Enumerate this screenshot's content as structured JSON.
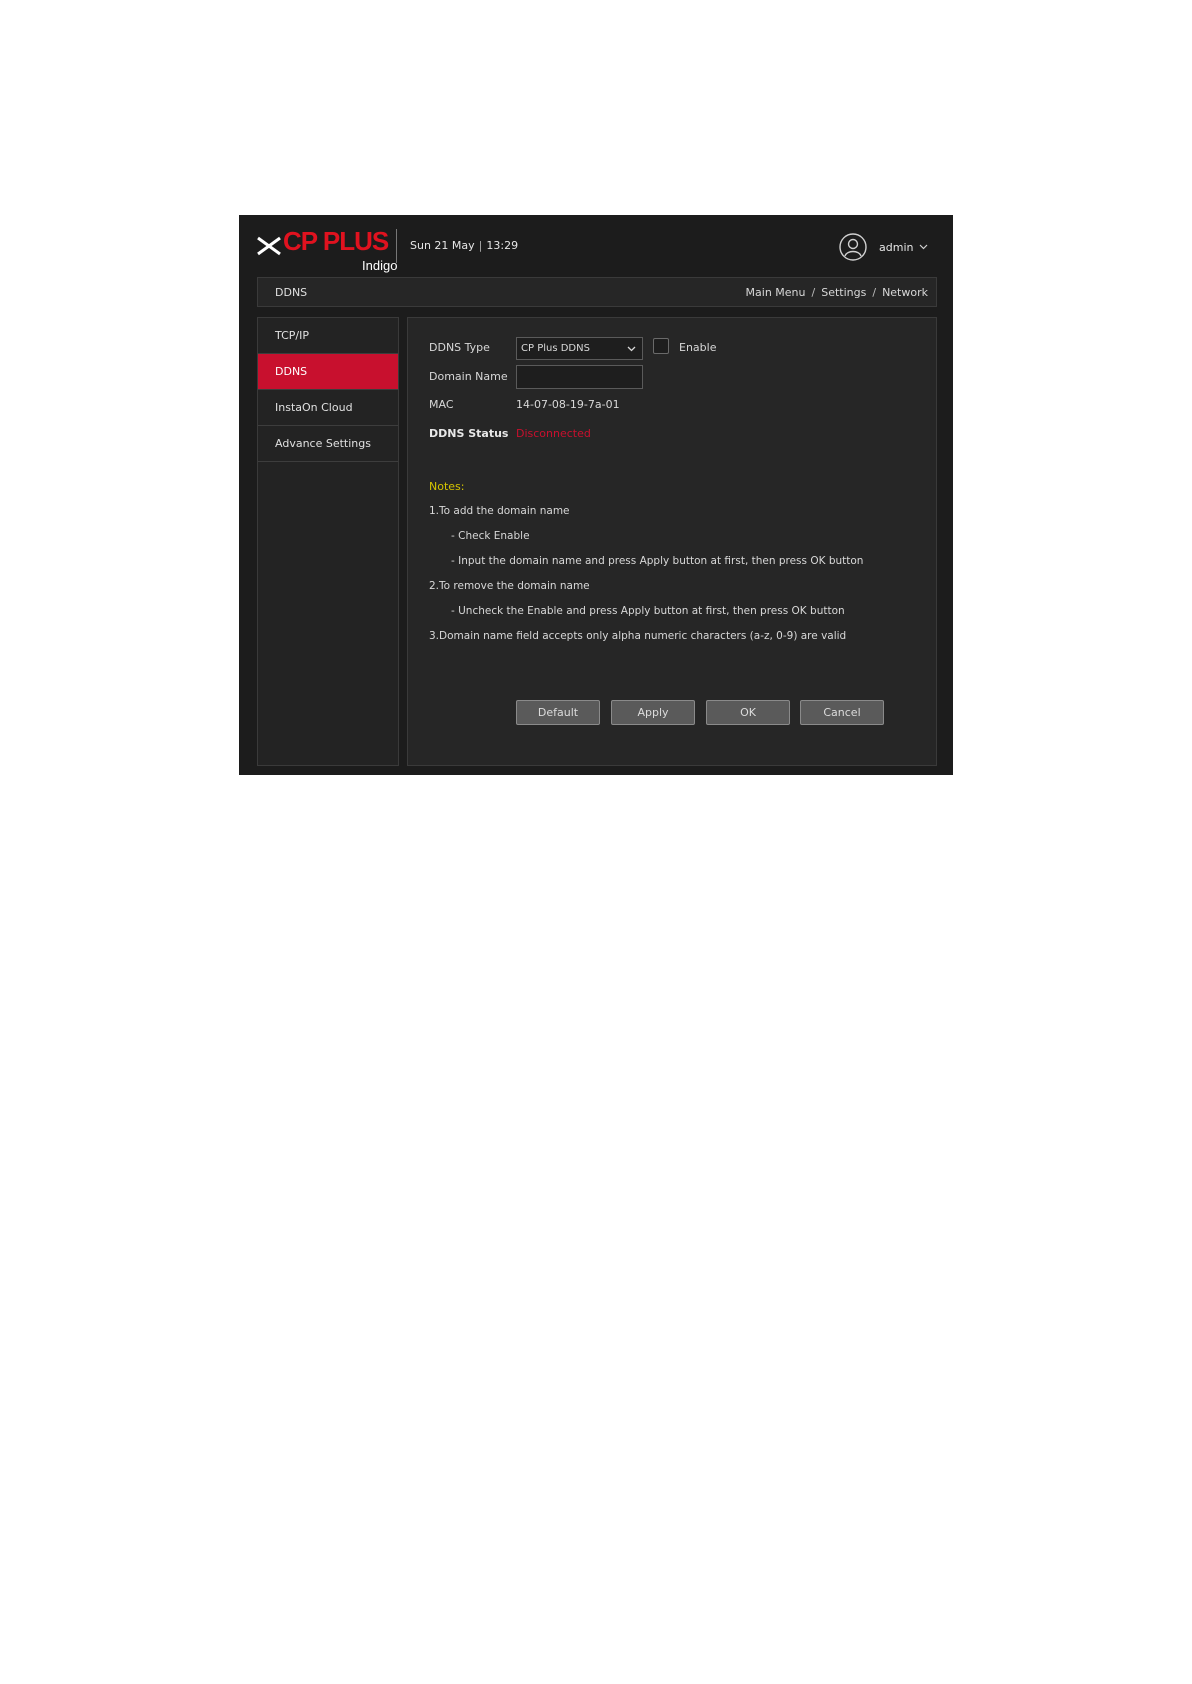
{
  "header": {
    "brand": "CP PLUS",
    "sub_brand": "Indigo",
    "day_date": "Sun 21 May",
    "time": "13:29",
    "time_separator": "|",
    "username": "admin",
    "icons": {
      "avatar": "user-circle-icon",
      "dropdown": "chevron-down-icon",
      "logo": "cp-plus-logo-icon"
    }
  },
  "titlebar": {
    "title": "DDNS",
    "breadcrumb": [
      "Main Menu",
      "Settings",
      "Network"
    ],
    "separator": "/"
  },
  "sidebar": {
    "items": [
      {
        "label": "TCP/IP",
        "active": false
      },
      {
        "label": "DDNS",
        "active": true
      },
      {
        "label": "InstaOn Cloud",
        "active": false
      },
      {
        "label": "Advance Settings",
        "active": false
      }
    ]
  },
  "form": {
    "ddns_type_label": "DDNS Type",
    "ddns_type_value": "CP Plus DDNS",
    "enable_label": "Enable",
    "enable_checked": false,
    "domain_name_label": "Domain Name",
    "domain_name_value": "",
    "mac_label": "MAC",
    "mac_value": "14-07-08-19-7a-01",
    "ddns_status_label": "DDNS Status",
    "ddns_status_value": "Disconnected"
  },
  "notes": {
    "title": "Notes:",
    "lines": [
      "1.To add the domain name",
      "- Check Enable",
      "- Input the domain name and press Apply button at first, then press OK button",
      "2.To remove the domain name",
      "- Uncheck the Enable and press Apply button at first, then press OK button",
      "3.Domain name field accepts only alpha numeric characters (a-z, 0-9) are valid"
    ]
  },
  "buttons": {
    "default": "Default",
    "apply": "Apply",
    "ok": "OK",
    "cancel": "Cancel"
  },
  "colors": {
    "accent_red": "#c8102e",
    "notes_yellow": "#d4c400",
    "background": "#1c1c1c"
  }
}
